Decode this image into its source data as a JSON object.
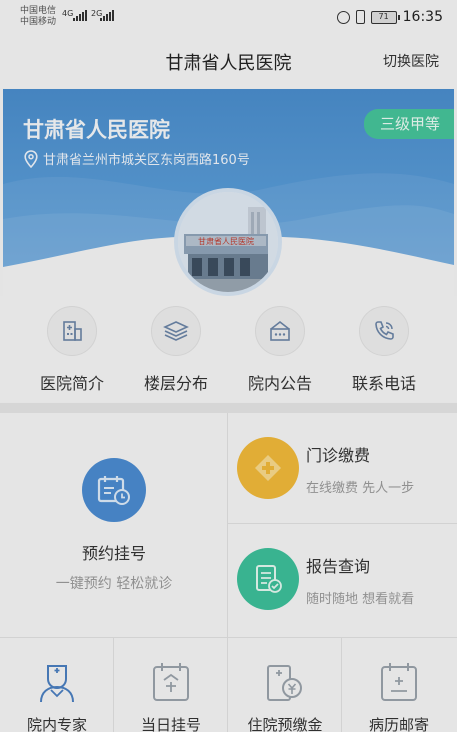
{
  "status_bar": {
    "carrier1": "中国电信",
    "carrier2": "中国移动",
    "sig1": "4G",
    "sig2": "2G",
    "battery": "71",
    "time": "16:35",
    "icons": [
      "signal-icon",
      "alarm-icon",
      "vibrate-icon",
      "battery-icon"
    ]
  },
  "header": {
    "title": "甘肃省人民医院",
    "switch_label": "切换医院"
  },
  "banner": {
    "name": "甘肃省人民医院",
    "level": "三级甲等",
    "address": "甘肃省兰州市城关区东岗西路160号",
    "photo_sign": "甘肃省人民医院",
    "icons": [
      "location-pin-icon"
    ]
  },
  "quick_menu": [
    {
      "label": "医院简介",
      "icon": "building-icon"
    },
    {
      "label": "楼层分布",
      "icon": "layers-icon"
    },
    {
      "label": "院内公告",
      "icon": "notice-icon"
    },
    {
      "label": "联系电话",
      "icon": "phone-icon"
    }
  ],
  "services": {
    "appointment": {
      "title": "预约挂号",
      "subtitle": "一键预约 轻松就诊",
      "icon": "calendar-clock-icon"
    },
    "payment": {
      "title": "门诊缴费",
      "subtitle": "在线缴费 先人一步",
      "icon": "medical-cross-icon"
    },
    "report": {
      "title": "报告查询",
      "subtitle": "随时随地 想看就看",
      "icon": "report-check-icon"
    }
  },
  "bottom_menu": [
    {
      "label": "院内专家",
      "icon": "doctor-icon"
    },
    {
      "label": "当日挂号",
      "icon": "today-calendar-icon"
    },
    {
      "label": "住院预缴金",
      "icon": "deposit-icon"
    },
    {
      "label": "病历邮寄",
      "icon": "record-mail-icon"
    }
  ],
  "colors": {
    "banner_blue": "#4a8dcc",
    "badge_green": "#46c39a",
    "appointment_blue": "#4b8bd0",
    "payment_orange": "#f0b83a",
    "report_green": "#3dbf9a"
  }
}
